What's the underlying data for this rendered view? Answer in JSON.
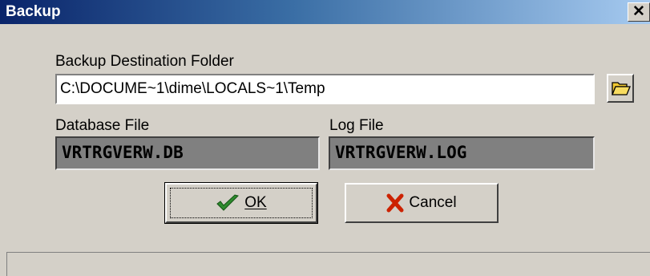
{
  "window": {
    "title": "Backup",
    "close_glyph": "✕"
  },
  "form": {
    "destination_label": "Backup Destination Folder",
    "destination_value": "C:\\DOCUME~1\\dime\\LOCALS~1\\Temp",
    "browse_icon": "folder-open-icon",
    "database_label": "Database File",
    "database_value": "VRTRGVERW.DB",
    "log_label": "Log File",
    "log_value": "VRTRGVERW.LOG"
  },
  "buttons": {
    "ok_label": "OK",
    "ok_icon": "checkmark-icon",
    "cancel_label": "Cancel",
    "cancel_icon": "x-icon"
  },
  "status": {
    "text": ""
  },
  "colors": {
    "title_start": "#0a246a",
    "title_end": "#a6caf0",
    "face": "#d4d0c8",
    "readonly_bg": "#808080",
    "check_green": "#2e8b2e",
    "cancel_red": "#cc2200",
    "folder_yellow": "#f0c830"
  }
}
